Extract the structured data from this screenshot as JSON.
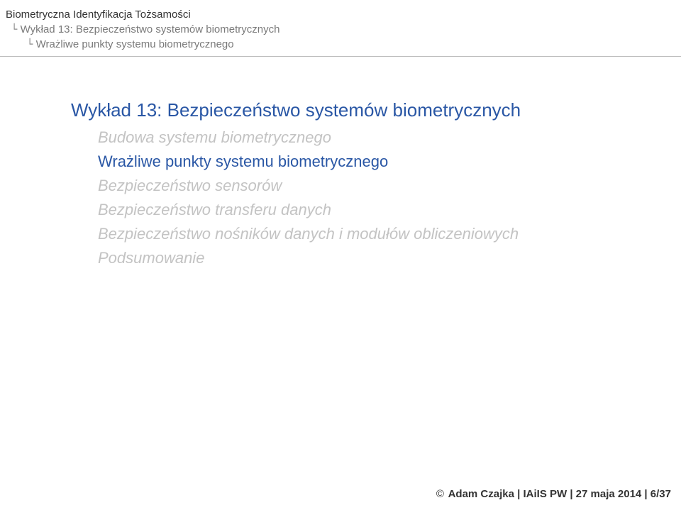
{
  "header": {
    "course": "Biometryczna Identyfikacja Tożsamości",
    "lecture": "Wykład 13: Bezpieczeństwo systemów biometrycznych",
    "section": "Wrażliwe punkty systemu biometrycznego"
  },
  "content": {
    "title": "Wykład 13: Bezpieczeństwo systemów biometrycznych",
    "items": [
      {
        "label": "Budowa systemu biometrycznego",
        "state": "past"
      },
      {
        "label": "Wrażliwe punkty systemu biometrycznego",
        "state": "current"
      },
      {
        "label": "Bezpieczeństwo sensorów",
        "state": "past"
      },
      {
        "label": "Bezpieczeństwo transferu danych",
        "state": "past"
      },
      {
        "label": "Bezpieczeństwo nośników danych i modułów obliczeniowych",
        "state": "past"
      },
      {
        "label": "Podsumowanie",
        "state": "past"
      }
    ]
  },
  "footer": {
    "text": "Adam Czajka | IAiIS PW | 27 maja 2014 | 6/37"
  }
}
